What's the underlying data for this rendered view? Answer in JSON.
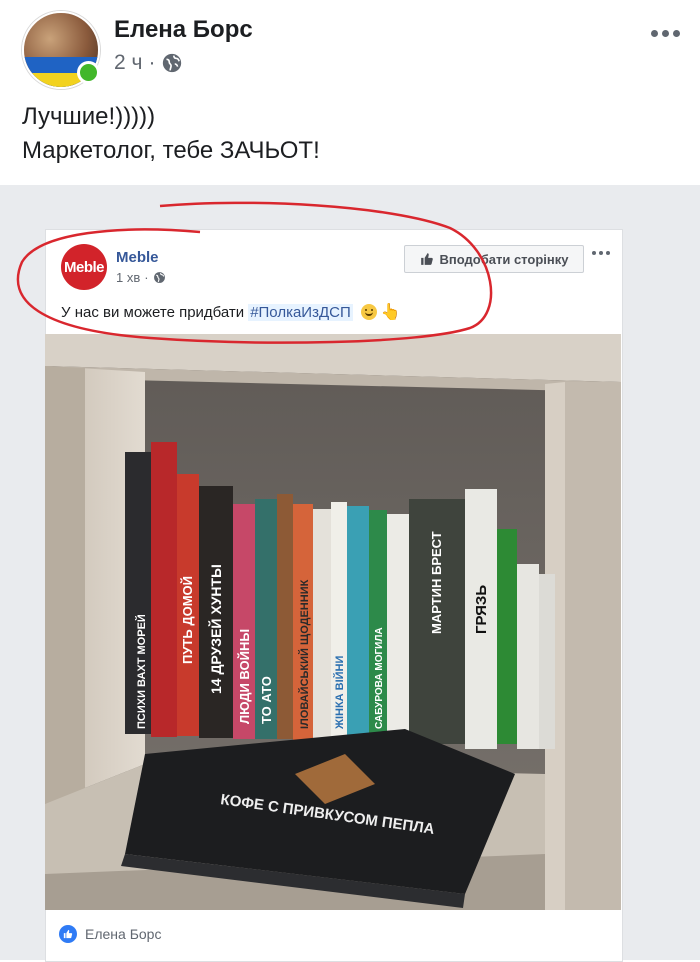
{
  "post": {
    "author": "Елена Борс",
    "time": "2 ч",
    "text_line1": "Лучшие!)))))",
    "text_line2": "Маркетолог, тебе ЗАЧЬОТ!",
    "avatar_flag_text": "УКРАЇНА"
  },
  "shared": {
    "page_name": "Meble",
    "logo_text": "Meble",
    "time": "1 хв",
    "like_button": "Вподобати сторінку",
    "text_before": "У нас ви можете придбати",
    "hashtag": "#ПолкаИзДСП",
    "reaction_name": "Елена Борс"
  },
  "books": {
    "titles": [
      "ПСИХИ ВАХТ МОРЕЙ",
      "ПУТЬ ДОМОЙ",
      "14 ДРУЗЕЙ ХУНТЫ",
      "ЛЮДИ ВОЙНЫ",
      "ТО АТО",
      "ІЛОВАЙСЬКИЙ ЩОДЕННИК",
      "ЖІНКА ВІЙНИ",
      "САБУРОВА МОГИЛА",
      "МАРТИН БРЕСТ",
      "ГРЯЗЬ",
      "КОФЕ С ПРИВКУСОМ ПЕПЛА"
    ]
  },
  "colors": {
    "facebook_blue": "#365899",
    "annotation_red": "#d9272e",
    "online_green": "#42b72a",
    "meble_red": "#d2232a"
  }
}
